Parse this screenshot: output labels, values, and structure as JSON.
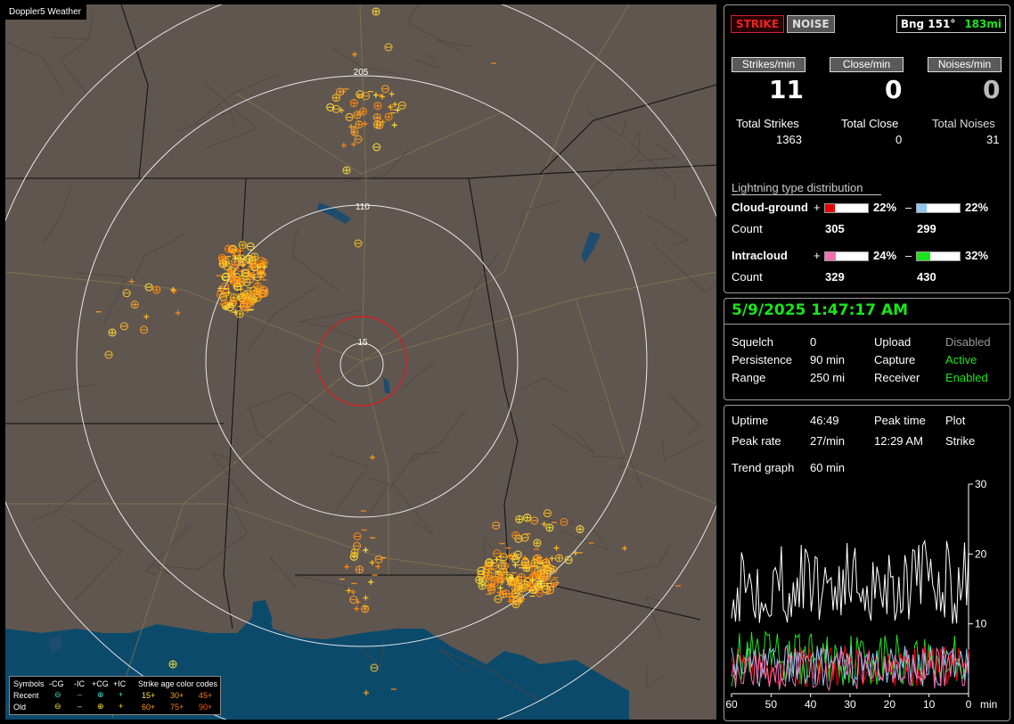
{
  "map": {
    "title": "Doppler5 Weather",
    "ring_labels": [
      "205",
      "110",
      "15"
    ],
    "legend": {
      "header_symbols": "Symbols",
      "cols": [
        "-CG",
        "-IC",
        "+CG",
        "+IC"
      ],
      "age_header": "Strike age color codes",
      "rows": [
        {
          "label": "Recent",
          "ages": [
            "15+",
            "30+",
            "45+"
          ]
        },
        {
          "label": "Old",
          "ages": [
            "60+",
            "75+",
            "90+"
          ]
        }
      ],
      "age_colors": [
        "#ffe033",
        "#ffa020",
        "#ff7a10"
      ]
    }
  },
  "stats": {
    "strike_btn": "STRIKE",
    "noise_btn": "NOISE",
    "bearing": "Bng 151°",
    "distance": "183mi",
    "headers": [
      "Strikes/min",
      "Close/min",
      "Noises/min"
    ],
    "rates": [
      "11",
      "0",
      "0"
    ],
    "total_labels": [
      "Total Strikes",
      "Total Close",
      "Total Noises"
    ],
    "totals": [
      "1363",
      "0",
      "31"
    ],
    "dist_title": "Lightning type distribution",
    "cg_label": "Cloud-ground",
    "ic_label": "Intracloud",
    "count_label": "Count",
    "plus": "+",
    "minus": "–",
    "cg_pos_pct": "22%",
    "cg_neg_pct": "22%",
    "ic_pos_pct": "24%",
    "ic_neg_pct": "32%",
    "cg_pos_count": "305",
    "cg_neg_count": "299",
    "ic_pos_count": "329",
    "ic_neg_count": "430",
    "cg_pos_frac": 0.22,
    "cg_neg_frac": 0.22,
    "ic_pos_frac": 0.24,
    "ic_neg_frac": 0.32
  },
  "status": {
    "datetime": "5/9/2025 1:47:17 AM",
    "squelch_label": "Squelch",
    "squelch": "0",
    "persistence_label": "Persistence",
    "persistence": "90 min",
    "range_label": "Range",
    "range": "250 mi",
    "upload_label": "Upload",
    "upload": "Disabled",
    "capture_label": "Capture",
    "capture": "Active",
    "receiver_label": "Receiver",
    "receiver": "Enabled"
  },
  "trend": {
    "uptime_label": "Uptime",
    "uptime": "46:49",
    "peaktime_label": "Peak time",
    "plot_label": "Plot",
    "peakrate_label": "Peak rate",
    "peakrate": "27/min",
    "peaktime": "12:29 AM",
    "plot": "Strike",
    "graph_label": "Trend graph",
    "graph_span": "60 min",
    "y_ticks": [
      "30",
      "20",
      "10"
    ],
    "x_ticks": [
      "60",
      "50",
      "40",
      "30",
      "20",
      "10",
      "0"
    ],
    "x_unit": "min",
    "chart_data": {
      "type": "line",
      "xlim": [
        60,
        0
      ],
      "ylim": [
        0,
        30
      ]
    }
  }
}
